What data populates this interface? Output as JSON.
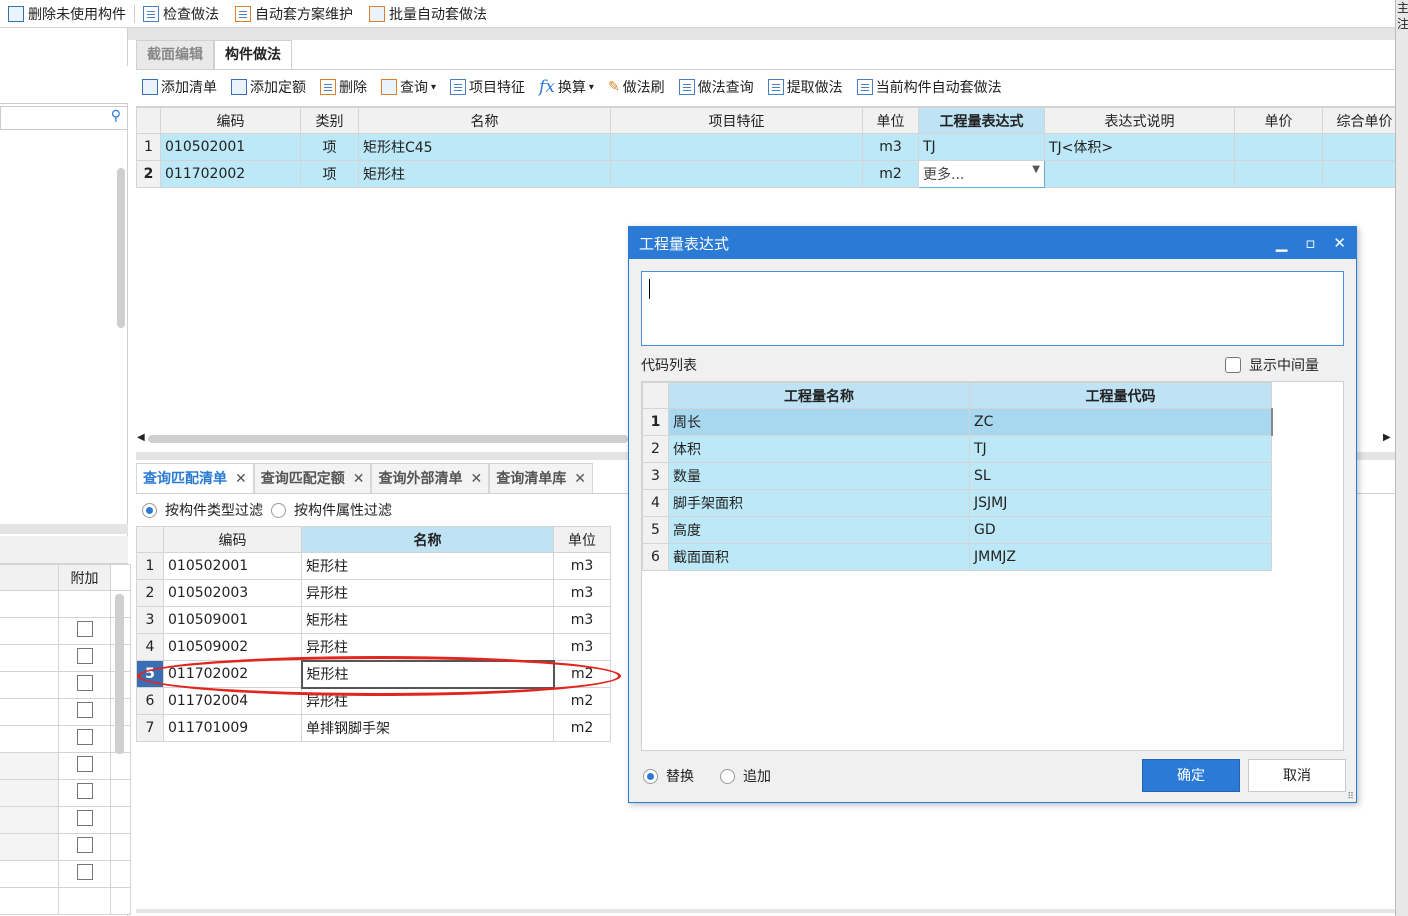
{
  "toolbar": [
    {
      "label": "删除未使用构件",
      "icon": "grid-delete-icon"
    },
    {
      "label": "检查做法",
      "icon": "check-doc-icon"
    },
    {
      "label": "自动套方案维护",
      "icon": "scheme-icon"
    },
    {
      "label": "批量自动套做法",
      "icon": "batch-icon"
    }
  ],
  "edge_chars": "主 注",
  "main_tabs": [
    "截面编辑",
    "构件做法"
  ],
  "tools": [
    {
      "label": "添加清单"
    },
    {
      "label": "添加定额"
    },
    {
      "label": "删除"
    },
    {
      "label": "查询",
      "dropdown": true
    },
    {
      "label": "项目特征"
    },
    {
      "label": "换算",
      "dropdown": true
    },
    {
      "label": "做法刷"
    },
    {
      "label": "做法查询"
    },
    {
      "label": "提取做法"
    },
    {
      "label": "当前构件自动套做法"
    }
  ],
  "upper_grid": {
    "headers": [
      "编码",
      "类别",
      "名称",
      "项目特征",
      "单位",
      "工程量表达式",
      "表达式说明",
      "单价",
      "综合单价"
    ],
    "rows": [
      {
        "n": "1",
        "code": "010502001",
        "type": "项",
        "name": "矩形柱C45",
        "feature": "",
        "unit": "m3",
        "expr": "TJ",
        "desc": "TJ<体积>"
      },
      {
        "n": "2",
        "code": "011702002",
        "type": "项",
        "name": "矩形柱",
        "feature": "",
        "unit": "m2",
        "expr": "更多...",
        "desc": ""
      }
    ]
  },
  "bottom_tabs": [
    "查询匹配清单",
    "查询匹配定额",
    "查询外部清单",
    "查询清单库"
  ],
  "filter": {
    "option1": "按构件类型过滤",
    "option2": "按构件属性过滤"
  },
  "match_grid": {
    "headers": [
      "编码",
      "名称",
      "单位"
    ],
    "rows": [
      {
        "n": "1",
        "code": "010502001",
        "name": "矩形柱",
        "unit": "m3"
      },
      {
        "n": "2",
        "code": "010502003",
        "name": "异形柱",
        "unit": "m3"
      },
      {
        "n": "3",
        "code": "010509001",
        "name": "矩形柱",
        "unit": "m3"
      },
      {
        "n": "4",
        "code": "010509002",
        "name": "异形柱",
        "unit": "m3"
      },
      {
        "n": "5",
        "code": "011702002",
        "name": "矩形柱",
        "unit": "m2"
      },
      {
        "n": "6",
        "code": "011702004",
        "name": "异形柱",
        "unit": "m2"
      },
      {
        "n": "7",
        "code": "011701009",
        "name": "单排钢脚手架",
        "unit": "m2"
      }
    ]
  },
  "left_panel": {
    "header": "附加"
  },
  "dialog": {
    "title": "工程量表达式",
    "expression_value": "",
    "code_list_label": "代码列表",
    "show_intermediate": "显示中间量",
    "headers": [
      "工程量名称",
      "工程量代码"
    ],
    "rows": [
      {
        "n": "1",
        "name": "周长",
        "code": "ZC"
      },
      {
        "n": "2",
        "name": "体积",
        "code": "TJ"
      },
      {
        "n": "3",
        "name": "数量",
        "code": "SL"
      },
      {
        "n": "4",
        "name": "脚手架面积",
        "code": "JSJMJ"
      },
      {
        "n": "5",
        "name": "高度",
        "code": "GD"
      },
      {
        "n": "6",
        "name": "截面面积",
        "code": "JMMJZ"
      }
    ],
    "replace": "替换",
    "append": "追加",
    "ok": "确定",
    "cancel": "取消"
  },
  "colors": {
    "accent": "#2b7bd6",
    "row_highlight": "#bde8f7",
    "annotation": "#e0261f"
  }
}
